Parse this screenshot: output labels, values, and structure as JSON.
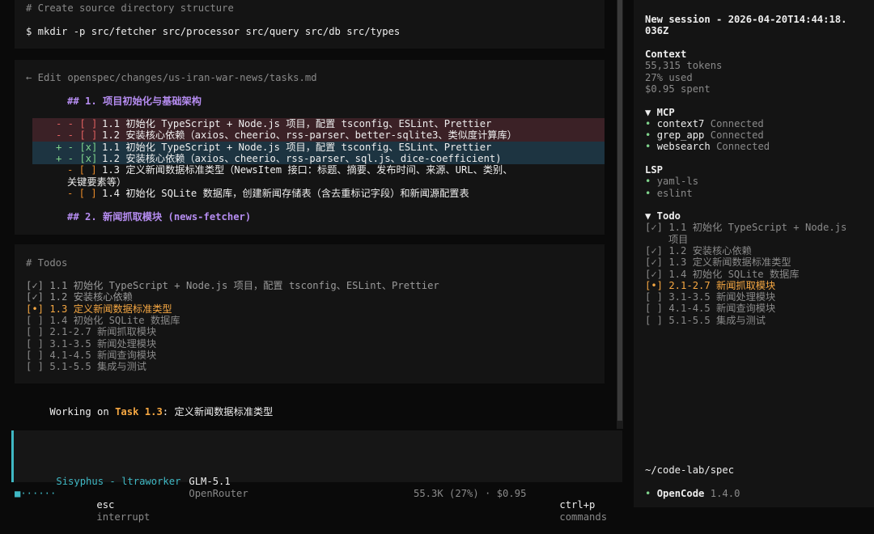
{
  "block1": {
    "comment": "# Create source directory structure",
    "command": "$ mkdir -p src/fetcher src/processor src/query src/db src/types"
  },
  "edit": {
    "header": "← Edit openspec/changes/us-iran-war-news/tasks.md",
    "heading1": "## 1. 项目初始化与基础架构",
    "del1_sign": "- - [ ]",
    "del1_text": "1.1 初始化 TypeScript + Node.js 项目，配置 tsconfig、ESLint、Prettier",
    "del2_sign": "- - [ ]",
    "del2_text": "1.2 安装核心依赖（axios、cheerio、rss-parser、better-sqlite3、类似度计算库）",
    "add1_sign": "+ - [x]",
    "add1_text": "1.1 初始化 TypeScript + Node.js 项目，配置 tsconfig、ESLint、Prettier",
    "add2_sign": "+ - [x]",
    "add2_text": "1.2 安装核心依赖（axios、cheerio、rss-parser、sql.js、dice-coefficient)",
    "ctx1_sign": "- [ ]",
    "ctx1_text": "1.3 定义新闻数据标准类型（NewsItem 接口：标题、摘要、发布时间、来源、URL、类别、",
    "ctx1_cont": "关键要素等）",
    "ctx2_sign": "- [ ]",
    "ctx2_text": "1.4 初始化 SQLite 数据库，创建新闻存储表（含去重标记字段）和新闻源配置表",
    "heading2": "## 2. 新闻抓取模块 (news-fetcher)"
  },
  "todos_block": {
    "title": "# Todos",
    "items": [
      "[✓] 1.1 初始化 TypeScript + Node.js 项目，配置 tsconfig、ESLint、Prettier",
      "[✓] 1.2 安装核心依赖",
      "[•] 1.3 定义新闻数据标准类型",
      "[ ] 1.4 初始化 SQLite 数据库",
      "[ ] 2.1-2.7 新闻抓取模块",
      "[ ] 3.1-3.5 新闻处理模块",
      "[ ] 4.1-4.5 新闻查询模块",
      "[ ] 5.1-5.5 集成与测试"
    ]
  },
  "working": {
    "prefix": "Working on ",
    "task": "Task 1.3",
    "suffix": ": 定义新闻数据标准类型"
  },
  "input": {
    "agent": "Sisyphus - ltraworker",
    "model": "GLM-5.1",
    "provider": "OpenRouter"
  },
  "statusbar": {
    "dots": "■······",
    "esc_key": "esc",
    "esc_label": "interrupt",
    "usage": "55.3K (27%) · $0.95",
    "cmd_key": "ctrl+p",
    "cmd_label": "commands"
  },
  "sidebar": {
    "session_line1": "New session - 2026-04-20T14:44:18.",
    "session_line2": "036Z",
    "context_title": "Context",
    "tokens": "55,315 tokens",
    "used": "27% used",
    "spent": "$0.95 spent",
    "mcp_title": "▼ MCP",
    "mcp": [
      {
        "name": "context7",
        "status": "Connected"
      },
      {
        "name": "grep_app",
        "status": "Connected"
      },
      {
        "name": "websearch",
        "status": "Connected"
      }
    ],
    "lsp_title": "LSP",
    "lsp": [
      "yaml-ls",
      "eslint"
    ],
    "todo_title": "▼ Todo",
    "todo1_a": "[✓] 1.1 初始化 TypeScript + Node.js",
    "todo1_b": "项目",
    "todos": [
      "[✓] 1.2 安装核心依赖",
      "[✓] 1.3 定义新闻数据标准类型",
      "[✓] 1.4 初始化 SQLite 数据库",
      "[•] 2.1-2.7 新闻抓取模块",
      "[ ] 3.1-3.5 新闻处理模块",
      "[ ] 4.1-4.5 新闻查询模块",
      "[ ] 5.1-5.5 集成与测试"
    ],
    "path": "~/code-lab/spec",
    "app_name": "OpenCode",
    "version": "1.4.0"
  },
  "colors": {
    "accent": "#f5a742",
    "input_bar": "#3fb8c4",
    "diff_remove_bg": "#3b2126",
    "diff_add_bg": "#1d3441"
  }
}
